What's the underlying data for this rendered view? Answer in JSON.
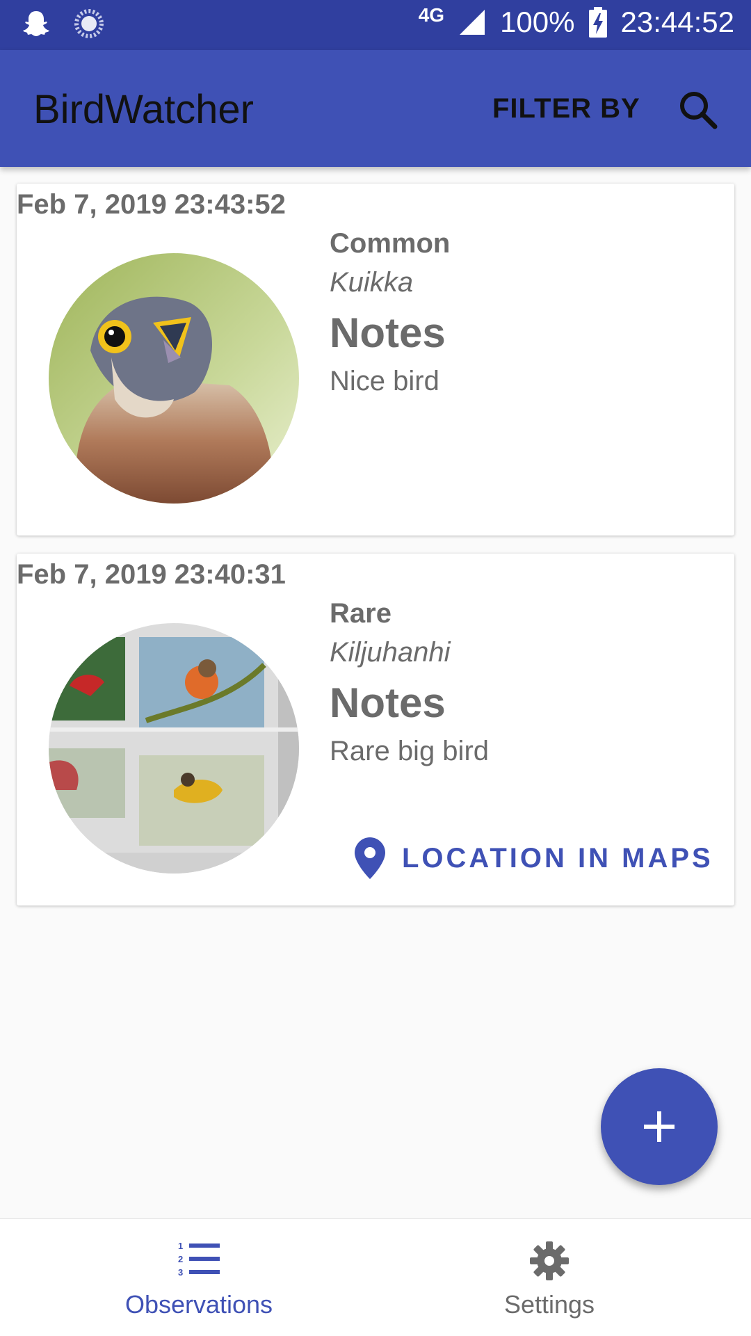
{
  "status_bar": {
    "network": "4G",
    "battery": "100%",
    "time": "23:44:52"
  },
  "app_bar": {
    "title": "BirdWatcher",
    "filter_label": "FILTER BY"
  },
  "observations": [
    {
      "date": "Feb 7, 2019 23:43:52",
      "rarity": "Common",
      "species": "Kuikka",
      "notes_heading": "Notes",
      "notes": "Nice bird"
    },
    {
      "date": "Feb 7, 2019 23:40:31",
      "rarity": "Rare",
      "species": "Kiljuhanhi",
      "notes_heading": "Notes",
      "notes": "Rare big bird",
      "location_label": "LOCATION IN MAPS"
    }
  ],
  "bottom_nav": {
    "items": [
      {
        "label": "Observations",
        "icon": "list-numbered-icon",
        "active": true
      },
      {
        "label": "Settings",
        "icon": "gear-icon",
        "active": false
      }
    ]
  },
  "colors": {
    "primary": "#3f51b5",
    "primary_dark": "#303f9f",
    "text_secondary": "#6b6b6b",
    "inactive_nav": "#6b6b6b"
  }
}
